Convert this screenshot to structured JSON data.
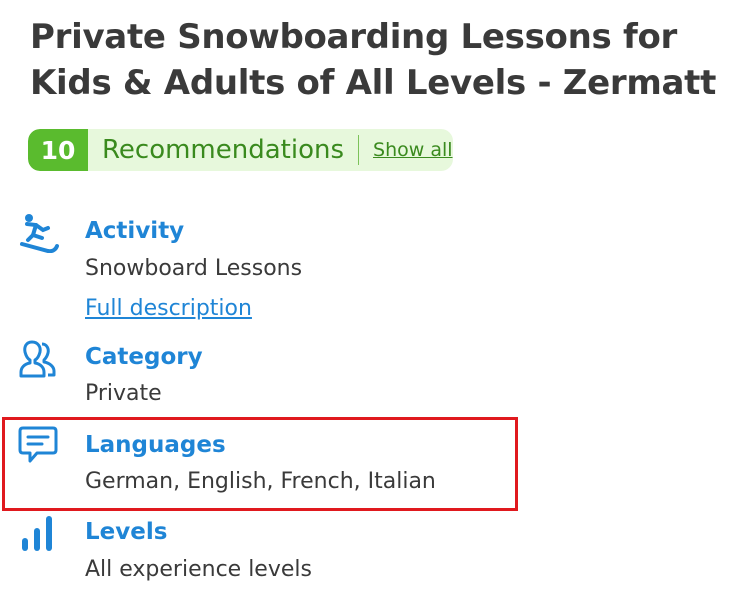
{
  "title": "Private Snowboarding Lessons for Kids & Adults of All Levels - Zermatt",
  "recommendations": {
    "count": "10",
    "label": "Recommendations",
    "show_all": "Show all"
  },
  "details": {
    "activity": {
      "label": "Activity",
      "value": "Snowboard Lessons",
      "link": "Full description",
      "icon": "snowboarder-icon"
    },
    "category": {
      "label": "Category",
      "value": "Private",
      "icon": "user-outline-icon"
    },
    "languages": {
      "label": "Languages",
      "value": "German, English, French, Italian",
      "icon": "chat-bubble-icon"
    },
    "levels": {
      "label": "Levels",
      "value": "All experience levels",
      "icon": "bar-chart-icon"
    }
  },
  "colors": {
    "accent_blue": "#1f85d6",
    "reco_green": "#5abb2e",
    "reco_bg": "#e7f8dc",
    "highlight_red": "#e0191e"
  }
}
